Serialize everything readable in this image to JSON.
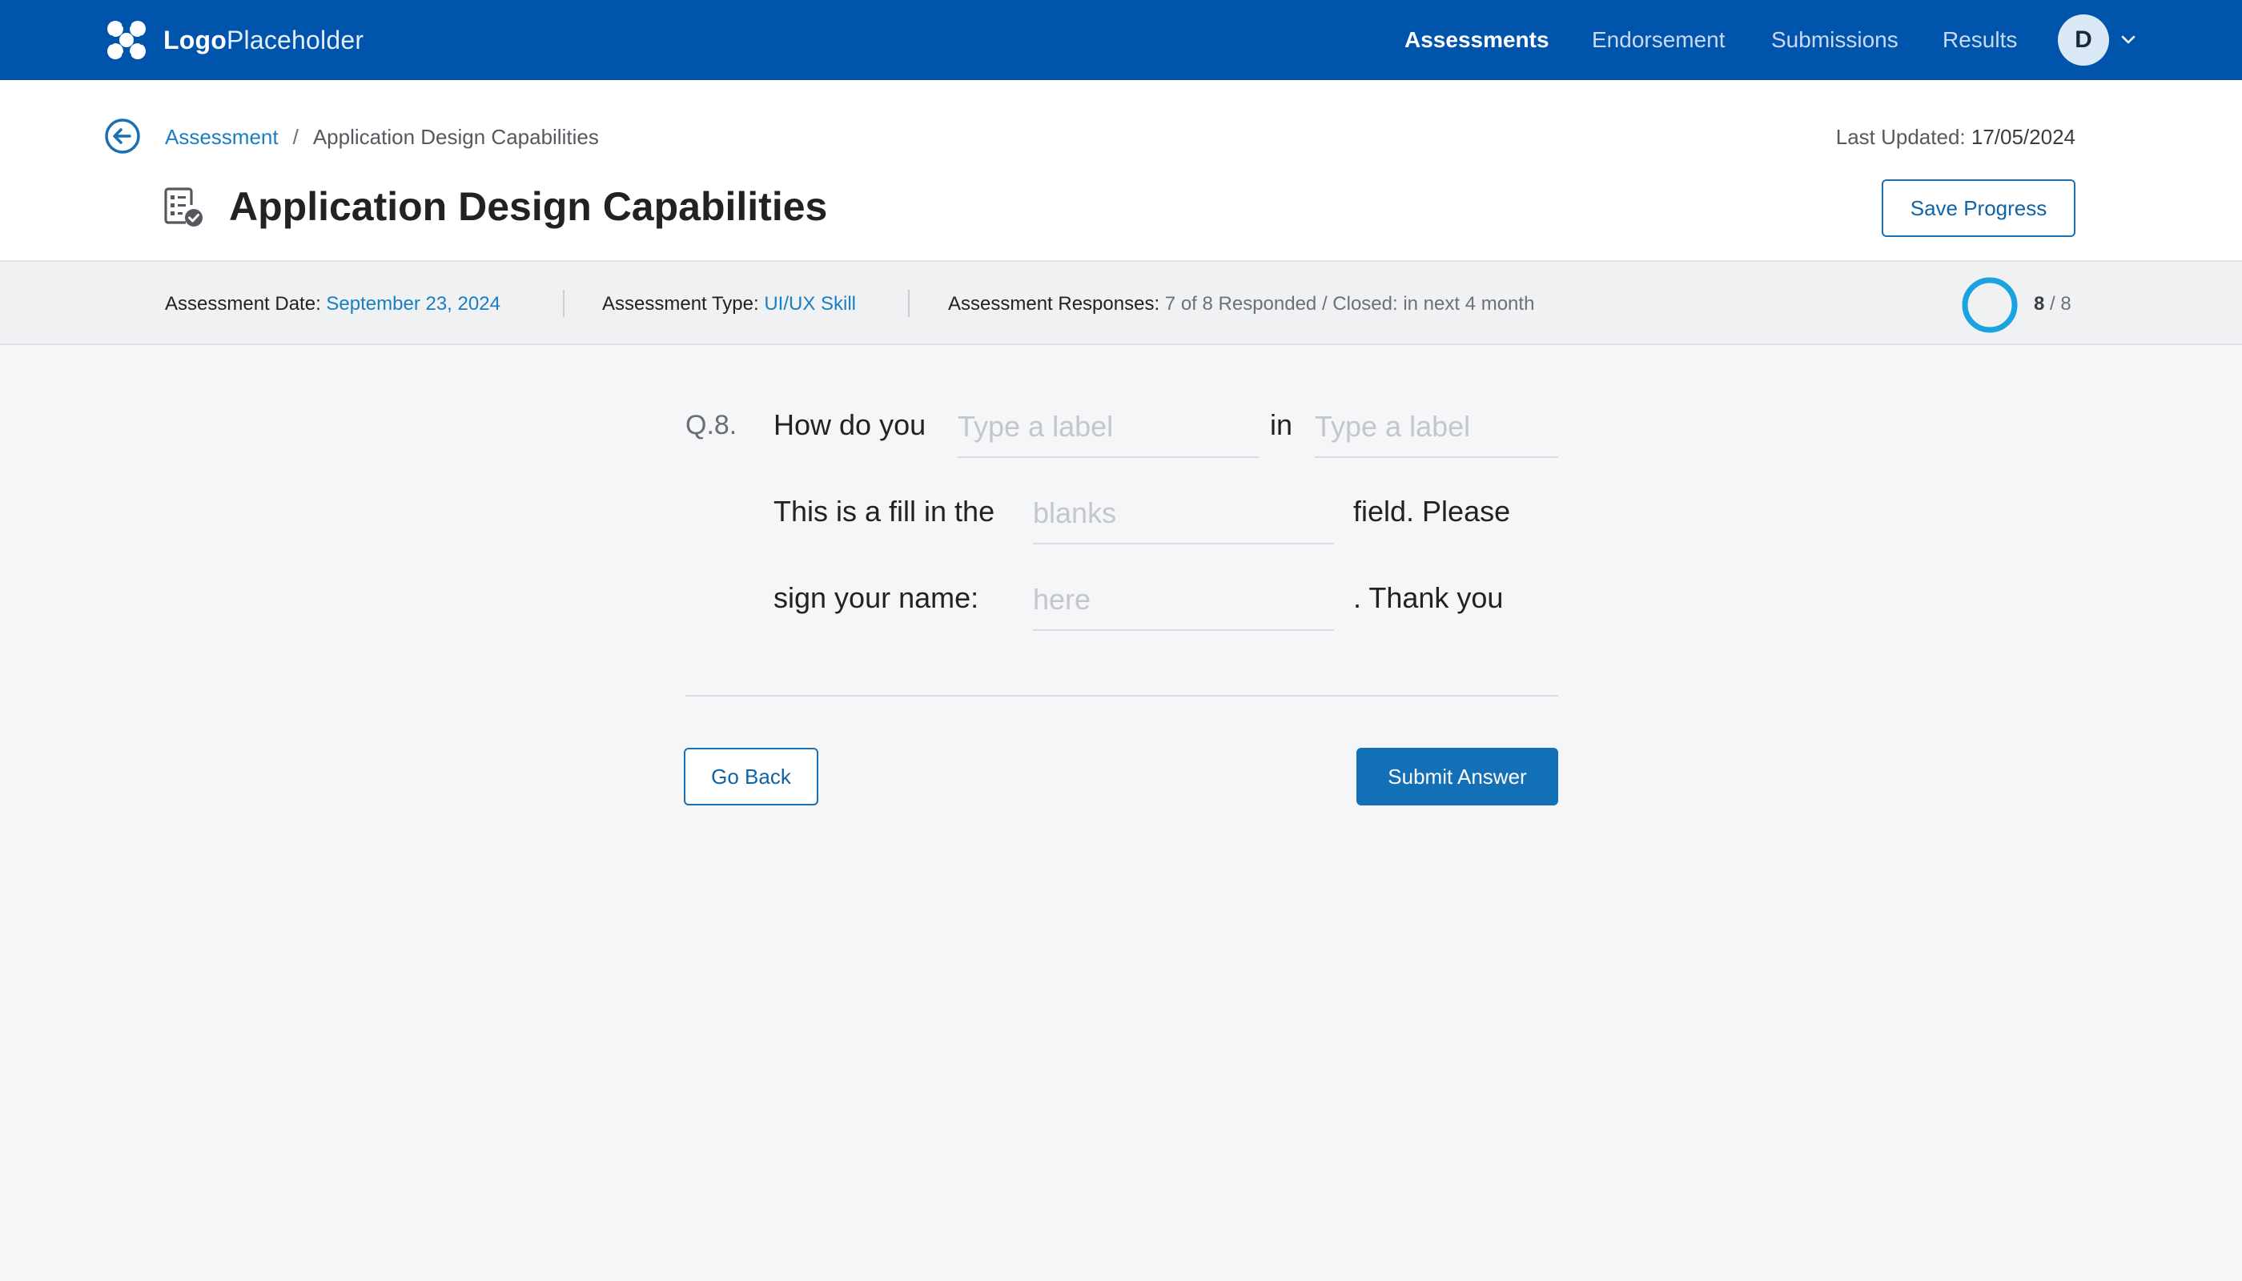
{
  "brand": {
    "logo_bold": "Logo",
    "logo_light": "Placeholder",
    "logo_icon": "logo-icon"
  },
  "nav": {
    "items": [
      {
        "label": "Assessments",
        "active": true
      },
      {
        "label": "Endorsement",
        "active": false
      },
      {
        "label": "Submissions",
        "active": false
      },
      {
        "label": "Results",
        "active": false
      }
    ],
    "avatar_initial": "D"
  },
  "header": {
    "breadcrumb": {
      "parent": "Assessment",
      "separator": "/",
      "current": "Application Design Capabilities"
    },
    "last_updated_label": "Last Updated:",
    "last_updated_value": "17/05/2024",
    "title": "Application Design Capabilities",
    "save_button": "Save Progress"
  },
  "meta": {
    "date_label": "Assessment Date:",
    "date_value": "September 23, 2024",
    "type_label": "Assessment Type:",
    "type_value": "UI/UX Skill",
    "responses_label": "Assessment Responses:",
    "responses_value": "7 of 8 Responded / Closed: in next 4 month",
    "progress_current": "8",
    "progress_total": "/ 8",
    "progress_fraction": 1.0
  },
  "question": {
    "number": "Q.8.",
    "line1_a": "How do you",
    "blank1_placeholder": "Type a label",
    "line1_b": "in",
    "blank2_placeholder": "Type a label",
    "line2_a": "This is a fill in the",
    "blank3_placeholder": "blanks",
    "line2_b": "field. Please",
    "line3_a": "sign your name:",
    "blank4_placeholder": "here",
    "line3_b": ". Thank you"
  },
  "actions": {
    "back": "Go Back",
    "submit": "Submit Answer"
  },
  "colors": {
    "nav_bg": "#0054ac",
    "accent": "#1a7ec2",
    "primary_button": "#1470b6",
    "progress_ring": "#1aa3de"
  }
}
